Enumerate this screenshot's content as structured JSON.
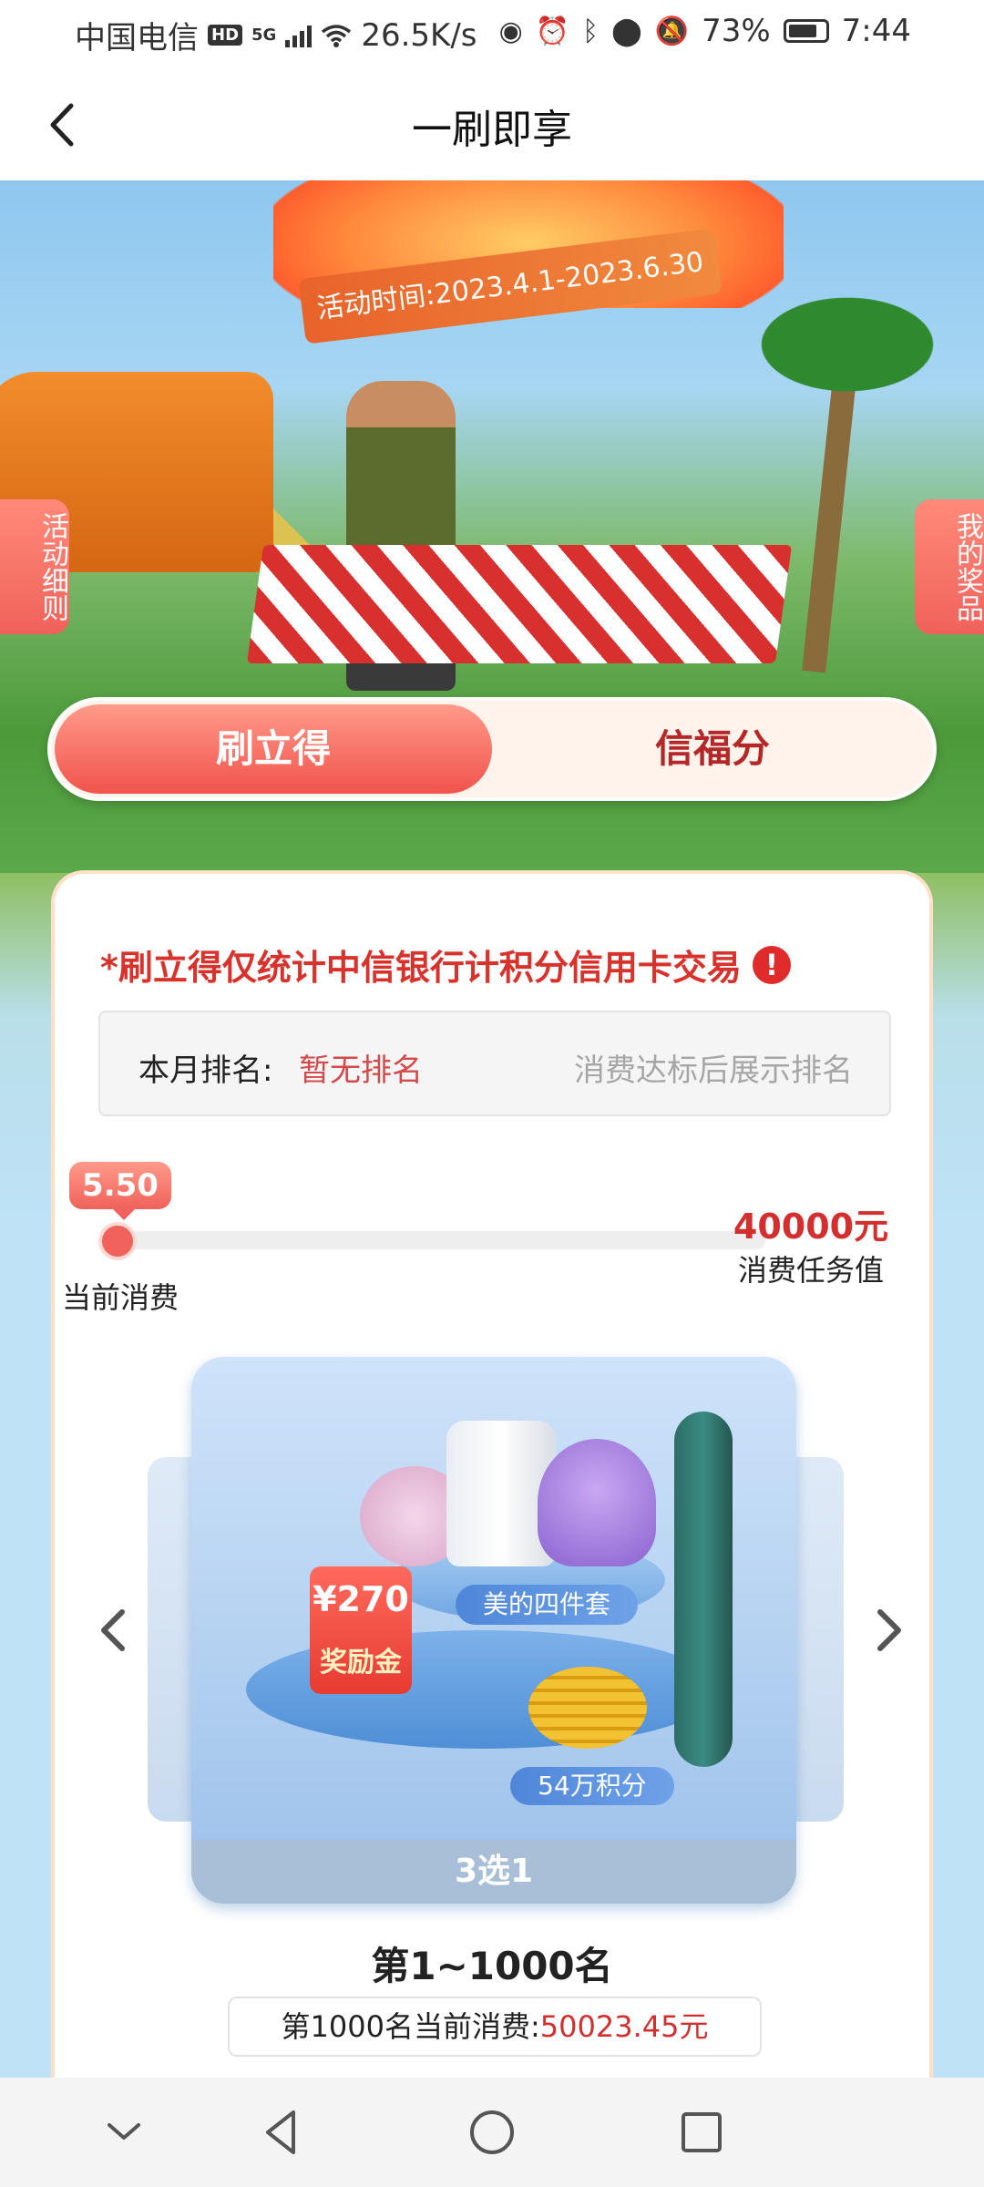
{
  "status_bar": {
    "carrier": "中国电信",
    "hd": "HD",
    "network": "5G",
    "speed": "26.5K/s",
    "battery": "73%",
    "time": "7:44"
  },
  "header": {
    "title": "一刷即享"
  },
  "hero": {
    "activity_time": "活动时间:2023.4.1-2023.6.30",
    "left_tab": "活动细则",
    "right_tab": "我的奖品"
  },
  "toggle": {
    "active_tab": "刷立得",
    "inactive_tab": "信福分"
  },
  "notice": {
    "text": "*刷立得仅统计中信银行计积分信用卡交易",
    "icon": "!"
  },
  "ranking": {
    "label": "本月排名:",
    "value": "暂无排名",
    "hint": "消费达标后展示排名"
  },
  "progress": {
    "current_value": "5.50",
    "current_label": "当前消费",
    "target_value": "40000元",
    "target_label": "消费任务值",
    "fraction": 0.0001375
  },
  "prize": {
    "voucher_amount": "¥270",
    "voucher_label": "奖励金",
    "midea_label": "美的四件套",
    "points_label": "54万积分",
    "choose_label": "3选1"
  },
  "tier": {
    "title": "第1~1000名",
    "spend_label": "第1000名当前消费:",
    "spend_value": "50023.45元"
  },
  "colors": {
    "accent": "#f0625b",
    "accent_text": "#d32f2f",
    "brand_dark": "#b52828"
  }
}
